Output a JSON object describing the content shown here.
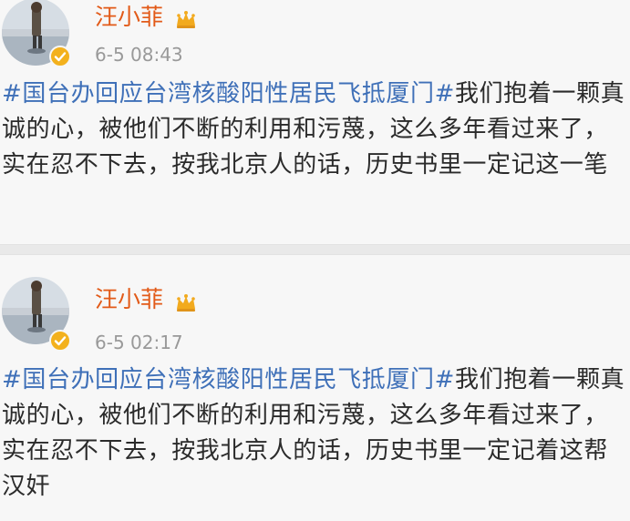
{
  "posts": [
    {
      "username": "汪小菲",
      "timestamp": "6-5 08:43",
      "hashtag": "#国台办回应台湾核酸阳性居民飞抵厦门#",
      "text": "我们抱着一颗真诚的心，被他们不断的利用和污蔑，这么多年看过来了，实在忍不下去，按我北京人的话，历史书里一定记这一笔",
      "badge_icon": "crown-icon",
      "avatar_icon": "avatar-icon",
      "verified_icon": "verified-badge-icon"
    },
    {
      "username": "汪小菲",
      "timestamp": "6-5 02:17",
      "hashtag": "#国台办回应台湾核酸阳性居民飞抵厦门#",
      "text": "我们抱着一颗真诚的心，被他们不断的利用和污蔑，这么多年看过来了，实在忍不下去，按我北京人的话，历史书里一定记着这帮汉奸",
      "badge_icon": "crown-icon",
      "avatar_icon": "avatar-icon",
      "verified_icon": "verified-badge-icon"
    }
  ],
  "colors": {
    "username": "#e25a18",
    "hashtag": "#3f70b8",
    "text": "#2b2b2b",
    "timestamp": "#999999",
    "verified": "#f3b11d",
    "background": "#f7f7f7",
    "divider": "#e9e9e9"
  }
}
